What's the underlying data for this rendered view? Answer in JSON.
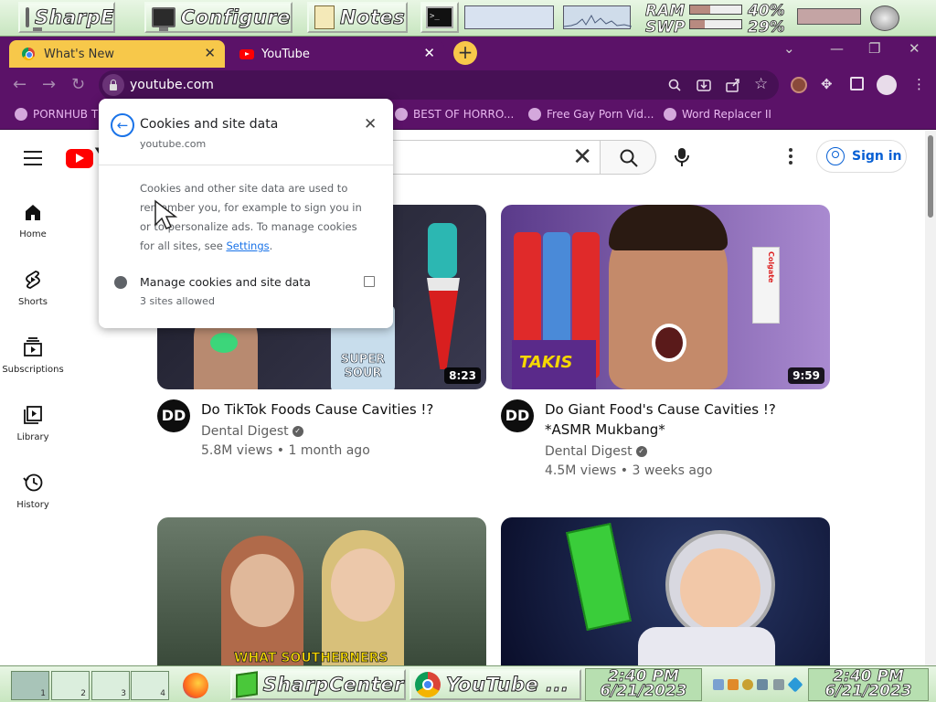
{
  "topbar": {
    "launchers": [
      {
        "label": "SharpE",
        "icon": "monitor-icon"
      },
      {
        "label": "Configure",
        "icon": "monitor-icon"
      },
      {
        "label": "Notes",
        "icon": "notepad-icon"
      }
    ],
    "terminal_glyph": ">_",
    "ram_label": "RAM",
    "swp_label": "SWP",
    "ram_percent": "40%",
    "swp_percent": "29%",
    "ram_fill": 0.4,
    "swp_fill": 0.29,
    "volume_icon": "speaker-icon"
  },
  "tabs": [
    {
      "title": "What's New",
      "favicon": "chrome-icon",
      "active": false
    },
    {
      "title": "YouTube",
      "favicon": "youtube-icon",
      "active": true
    }
  ],
  "new_tab_label": "+",
  "omnibox": {
    "url": "youtube.com"
  },
  "bookmarks": [
    "PORNHUB T",
    "BEST OF HORRO...",
    "Free Gay Porn Vid...",
    "Word Replacer II"
  ],
  "youtube": {
    "logo_text": "Y",
    "sign_in": "Sign in",
    "sidebar": [
      {
        "label": "Home",
        "icon": "home-icon"
      },
      {
        "label": "Shorts",
        "icon": "shorts-icon"
      },
      {
        "label": "Subscriptions",
        "icon": "subscriptions-icon"
      },
      {
        "label": "Library",
        "icon": "library-icon"
      },
      {
        "label": "History",
        "icon": "history-icon"
      }
    ],
    "videos": [
      {
        "title": "Do TikTok Foods Cause Cavities !?",
        "channel": "Dental Digest",
        "meta": "5.8M views • 1 month ago",
        "duration": "8:23",
        "thumb_text_1": "SUPER",
        "thumb_text_2": "SOUR"
      },
      {
        "title": "Do Giant Food's Cause Cavities !? *ASMR Mukbang*",
        "channel": "Dental Digest",
        "meta": "4.5M views • 3 weeks ago",
        "duration": "9:59",
        "thumb_text_1": "TAKIS",
        "thumb_text_2": "Colgate"
      },
      {
        "thumb_text_1": "WHAT SOUTHERNERS"
      },
      {}
    ],
    "channel_avatar_text": "DD"
  },
  "popup": {
    "title": "Cookies and site data",
    "domain": "youtube.com",
    "body": "Cookies and other site data are used to remember you, for example to sign you in or to personalize ads. To manage cookies for all sites, see ",
    "settings_link": "Settings",
    "body_end": ".",
    "manage_label": "Manage cookies and site data",
    "manage_sub": "3 sites allowed"
  },
  "bottombar": {
    "workspaces": [
      "1",
      "2",
      "3",
      "4"
    ],
    "tasks": [
      {
        "label": "SharpCenter",
        "icon": "green-cube-icon"
      },
      {
        "label": "YouTube  ...",
        "icon": "chrome-icon"
      }
    ],
    "clock_time": "2:40 PM",
    "clock_date": "6/21/2023"
  }
}
